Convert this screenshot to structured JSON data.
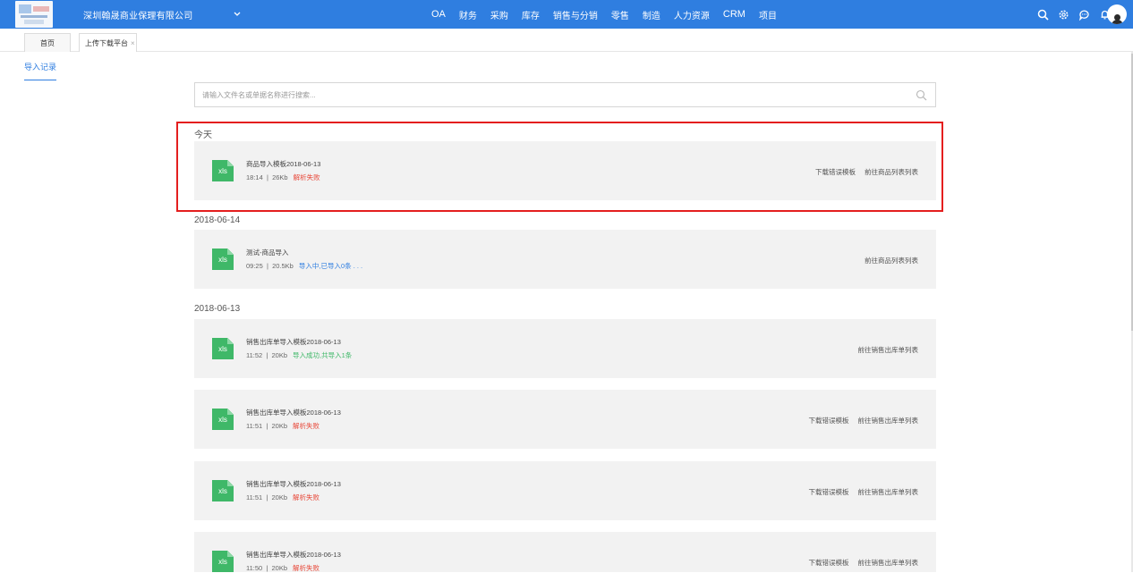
{
  "topbar": {
    "company": "深圳翰晟商业保理有限公司",
    "nav": [
      "OA",
      "财务",
      "采购",
      "库存",
      "销售与分销",
      "零售",
      "制造",
      "人力资源",
      "CRM",
      "项目"
    ],
    "icons": [
      "search-icon",
      "gear-icon",
      "chat-icon",
      "bell-icon",
      "avatar"
    ],
    "bg_color": "#2f7ee0"
  },
  "tabs": {
    "home": "首页",
    "active": "上传下载平台",
    "close": "×"
  },
  "subnav": {
    "label": "导入记录"
  },
  "search": {
    "placeholder": "请输入文件名或单据名称进行搜索..."
  },
  "groups": [
    {
      "title": "今天",
      "records": [
        {
          "ext": "xls",
          "name": "商品导入模板2018-06-13",
          "time": "18:14",
          "size": "26Kb",
          "status": "解析失败",
          "status_type": "fail",
          "actions": [
            "下载错误模板",
            "前往商品列表列表"
          ]
        }
      ]
    },
    {
      "title": "2018-06-14",
      "records": [
        {
          "ext": "xls",
          "name": "测试-商品导入",
          "time": "09:25",
          "size": "20.5Kb",
          "status": "导入中,已导入0条 . . .",
          "status_type": "progress",
          "actions": [
            "前往商品列表列表"
          ]
        }
      ]
    },
    {
      "title": "2018-06-13",
      "records": [
        {
          "ext": "xls",
          "name": "销售出库单导入模板2018-06-13",
          "time": "11:52",
          "size": "20Kb",
          "status": "导入成功,共导入1条",
          "status_type": "ok",
          "actions": [
            "前往销售出库单列表"
          ]
        },
        {
          "ext": "xls",
          "name": "销售出库单导入模板2018-06-13",
          "time": "11:51",
          "size": "20Kb",
          "status": "解析失败",
          "status_type": "fail",
          "actions": [
            "下载错误模板",
            "前往销售出库单列表"
          ]
        },
        {
          "ext": "xls",
          "name": "销售出库单导入模板2018-06-13",
          "time": "11:51",
          "size": "20Kb",
          "status": "解析失败",
          "status_type": "fail",
          "actions": [
            "下载错误模板",
            "前往销售出库单列表"
          ]
        },
        {
          "ext": "xls",
          "name": "销售出库单导入模板2018-06-13",
          "time": "11:50",
          "size": "20Kb",
          "status": "解析失败",
          "status_type": "fail",
          "actions": [
            "下载错误模板",
            "前往销售出库单列表"
          ]
        }
      ]
    }
  ],
  "colors": {
    "fail": "#e8493a",
    "progress": "#2f7ee0",
    "ok": "#3fb868",
    "highlight": "#e41e1e"
  }
}
